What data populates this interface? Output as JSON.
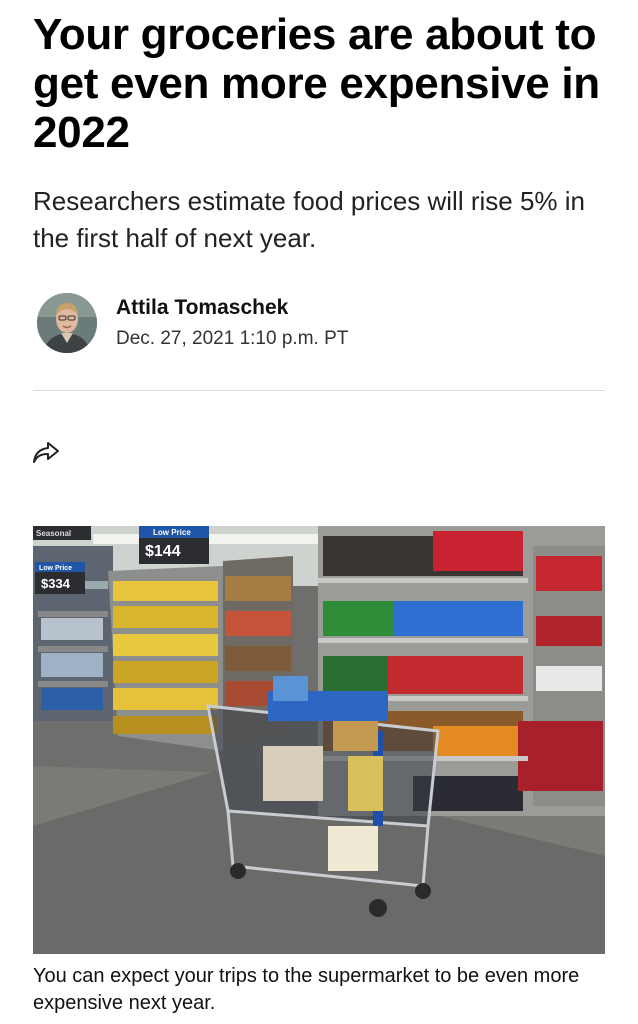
{
  "article": {
    "headline": "Your groceries are about to get even more expensive in 2022",
    "dek": "Researchers estimate food prices will rise 5% in the first half of next year.",
    "author": "Attila Tomaschek",
    "date": "Dec. 27, 2021 1:10 p.m. PT"
  },
  "image": {
    "caption": "You can expect your trips to the supermarket to be even more expensive next year.",
    "signs": {
      "seasonal": "Seasonal",
      "low_price_main": "Low Price",
      "price_main": "$144",
      "low_price_left": "Low Price",
      "price_left": "$334"
    }
  },
  "icons": {
    "share": "share-arrow-icon",
    "avatar": "author-avatar"
  }
}
